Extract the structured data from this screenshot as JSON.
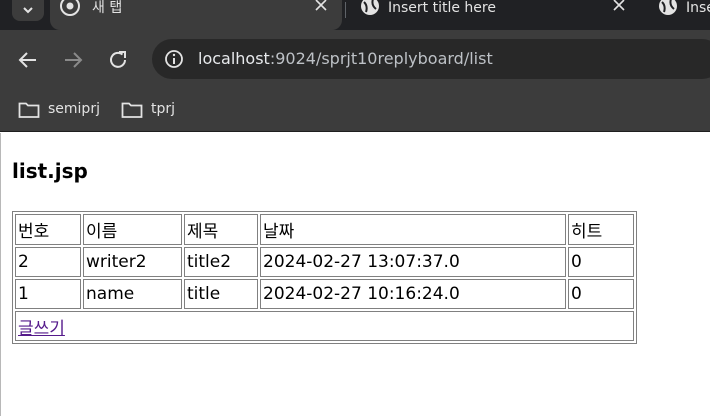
{
  "browser": {
    "tabs": [
      {
        "label": "새 탭",
        "active": true
      },
      {
        "label": "Insert title here",
        "active": false
      },
      {
        "label": "Inse",
        "active": false
      }
    ],
    "address_bar": {
      "host": "localhost",
      "path": ":9024/sprjt10replyboard/list"
    },
    "bookmarks": [
      {
        "label": "semiprj"
      },
      {
        "label": "tprj"
      }
    ]
  },
  "page": {
    "heading": "list.jsp",
    "table": {
      "headers": [
        "번호",
        "이름",
        "제목",
        "날짜",
        "히트"
      ],
      "rows": [
        [
          "2",
          "writer2",
          "title2",
          "2024-02-27 13:07:37.0",
          "0"
        ],
        [
          "1",
          "name",
          "title",
          "2024-02-27 10:16:24.0",
          "0"
        ]
      ],
      "write_link": "글쓰기"
    }
  },
  "colors": {
    "chrome_dark": "#202124",
    "toolbar": "#3c3c3c",
    "visited_link": "#551a8b"
  }
}
